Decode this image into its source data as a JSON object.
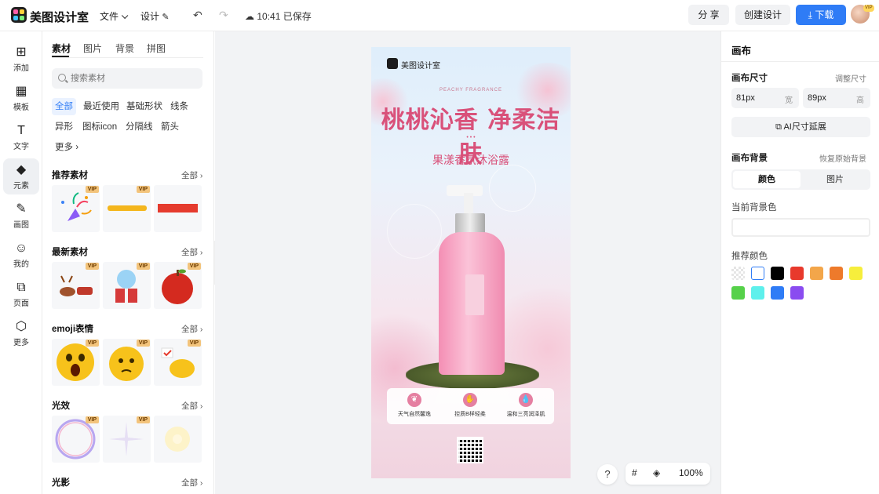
{
  "app": {
    "brand": "美图设计室",
    "saved_status": "10:41 已保存"
  },
  "topbar": {
    "menu_file": "文件",
    "menu_design": "设计",
    "share": "分 享",
    "create_design": "创建设计",
    "download": "下载",
    "avatar_badge": "VIP"
  },
  "rail": [
    {
      "label": "添加",
      "icon": "plus-square-icon"
    },
    {
      "label": "模板",
      "icon": "template-icon"
    },
    {
      "label": "文字",
      "icon": "text-icon"
    },
    {
      "label": "元素",
      "icon": "shapes-icon"
    },
    {
      "label": "画图",
      "icon": "draw-icon"
    },
    {
      "label": "我的",
      "icon": "user-icon"
    },
    {
      "label": "页面",
      "icon": "page-icon"
    },
    {
      "label": "更多",
      "icon": "cube-icon"
    }
  ],
  "panel": {
    "tabs": [
      "素材",
      "图片",
      "背景",
      "拼图"
    ],
    "search_placeholder": "搜索素材",
    "chips": [
      "全部",
      "最近使用",
      "基础形状",
      "线条",
      "异形",
      "图标icon",
      "分隔线",
      "箭头",
      "更多"
    ],
    "all_label": "全部",
    "vip_label": "VIP",
    "sections": [
      {
        "title": "推荐素材",
        "items": [
          "party-popper",
          "yellow-brush-stroke",
          "red-bar"
        ]
      },
      {
        "title": "最新素材",
        "items": [
          "reindeer-sleigh",
          "snow-globe-gifts",
          "red-apple"
        ]
      },
      {
        "title": "emoji表情",
        "items": [
          "shocked-emoji",
          "thinking-emoji",
          "chick-emoji"
        ]
      },
      {
        "title": "光效",
        "items": [
          "bubble-ring",
          "star-sparkle",
          "glow-orb"
        ]
      },
      {
        "title": "光影",
        "items": []
      }
    ]
  },
  "poster": {
    "brand": "美图设计室",
    "subtitle_en": "PEACHY FRAGRANCE",
    "title": "桃桃沁香 净柔洁肤",
    "dots": "• • •",
    "subtitle": "果漾香氛沐浴露",
    "features": [
      "天气自然馨逸",
      "控质B样轻柔",
      "温和三亮润泽肌"
    ]
  },
  "zoom": {
    "help": "?",
    "level": "100%"
  },
  "right": {
    "title": "画布",
    "size_label": "画布尺寸",
    "size_link": "调整尺寸",
    "width_value": "81px",
    "width_unit": "宽",
    "height_value": "89px",
    "height_unit": "高",
    "ai_button": "AI尺寸延展",
    "bg_label": "画布背景",
    "bg_reset": "恢复原始背景",
    "bg_tabs": [
      "颜色",
      "图片"
    ],
    "current_bg_label": "当前背景色",
    "recommended_label": "推荐颜色",
    "swatches": [
      "transparent",
      "#ffffff",
      "#000000",
      "#e8392c",
      "#f3a64a",
      "#ee7a2b",
      "#f6ee3c",
      "#56d14a",
      "#5ef0ec",
      "#2f7cf6",
      "#8a4cf0"
    ]
  }
}
